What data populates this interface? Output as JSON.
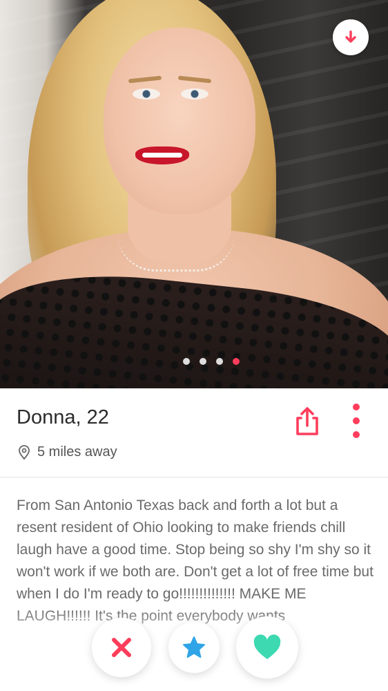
{
  "profile": {
    "name_age": "Donna, 22",
    "distance": "5 miles away",
    "bio": "From San Antonio Texas back and forth a lot but a resent resident of Ohio looking to make friends chill laugh have a good time. Stop being so shy I'm shy so it won't work if we both are. Don't get a lot of free time but when I do I'm ready to go!!!!!!!!!!!!!! MAKE ME LAUGH!!!!!! It's the point everybody wants"
  },
  "photo": {
    "count": 4,
    "active_index": 3
  },
  "icons": {
    "download": "arrow-down-icon",
    "share": "share-icon",
    "more": "more-vertical-icon",
    "location": "location-pin-icon",
    "nope": "close-icon",
    "super_like": "star-icon",
    "like": "heart-icon"
  },
  "colors": {
    "accent": "#fd3d5b",
    "super_like": "#2fa4e7",
    "like": "#3dd9b0",
    "text": "#2b2b2b",
    "muted": "#6a6a6a"
  }
}
